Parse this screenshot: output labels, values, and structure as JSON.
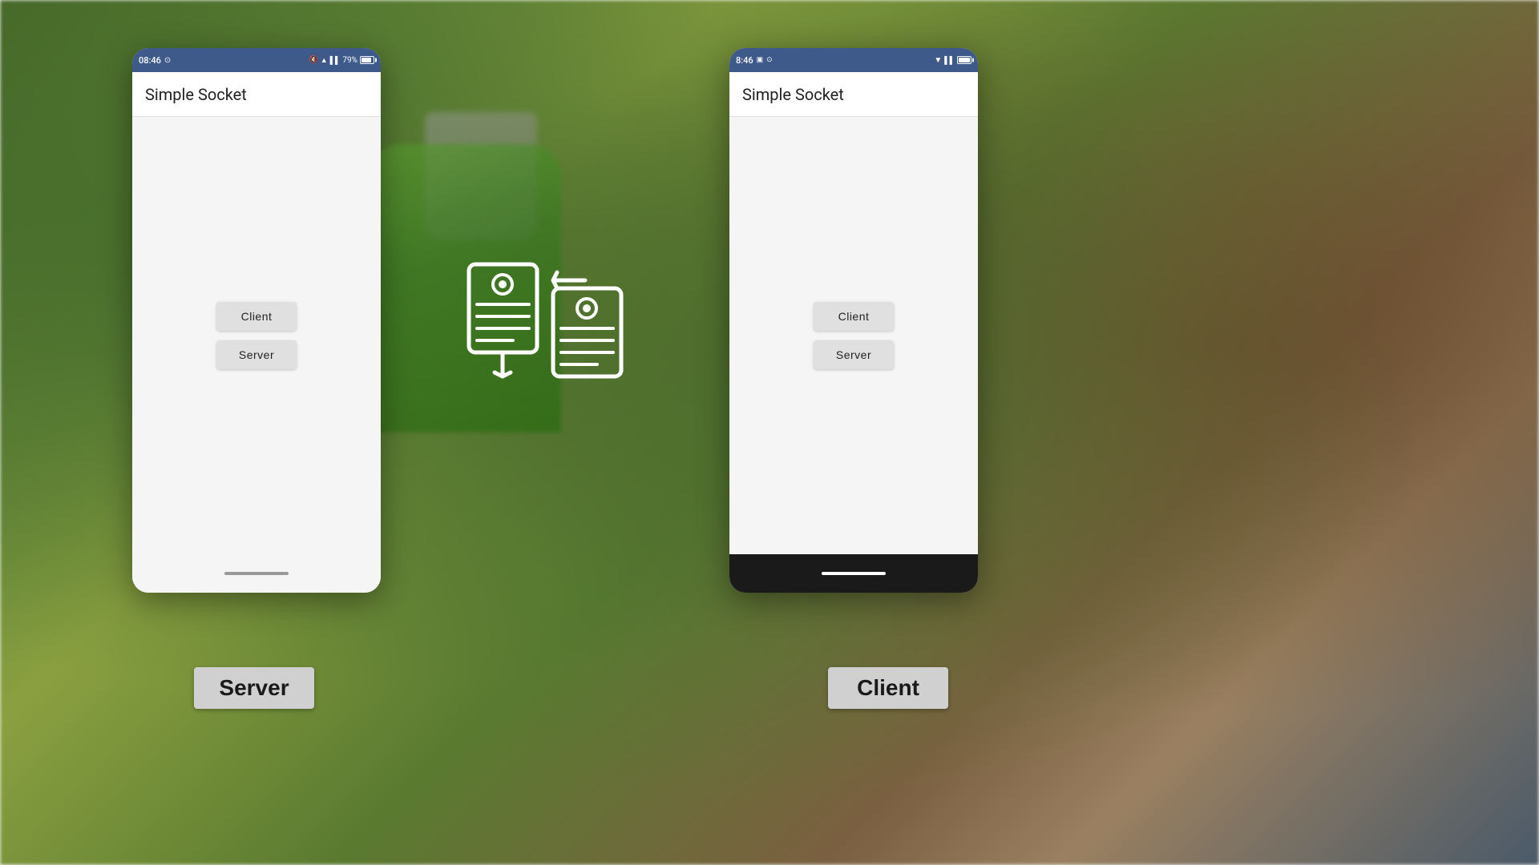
{
  "background": {
    "description": "blurred outdoor scene with plants and android robot"
  },
  "left_phone": {
    "label": "Server",
    "status_bar": {
      "time": "08:46",
      "battery": "79%"
    },
    "app_title": "Simple Socket",
    "buttons": [
      {
        "label": "Client"
      },
      {
        "label": "Server"
      }
    ],
    "nav_style": "light"
  },
  "right_phone": {
    "label": "Client",
    "status_bar": {
      "time": "8:46"
    },
    "app_title": "Simple Socket",
    "buttons": [
      {
        "label": "Client"
      },
      {
        "label": "Server"
      }
    ],
    "nav_style": "dark"
  },
  "center_icon": {
    "description": "data transfer / socket communication icon with two documents and arrows"
  }
}
